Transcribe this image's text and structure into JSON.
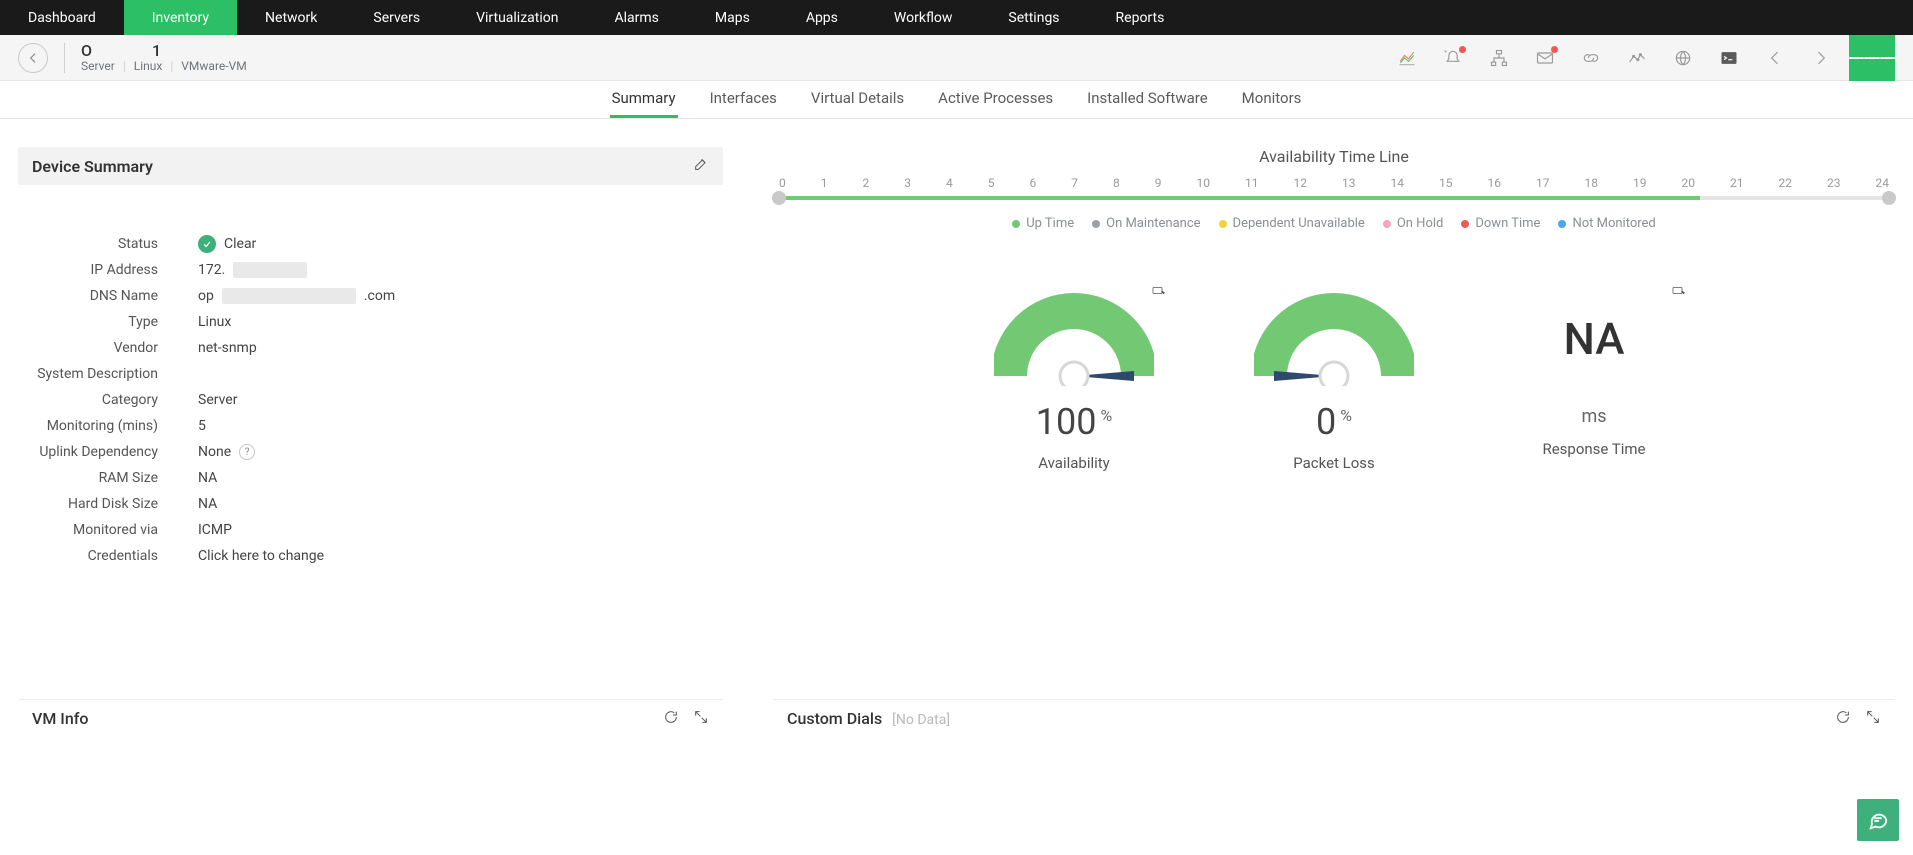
{
  "nav": {
    "items": [
      "Dashboard",
      "Inventory",
      "Network",
      "Servers",
      "Virtualization",
      "Alarms",
      "Maps",
      "Apps",
      "Workflow",
      "Settings",
      "Reports"
    ],
    "activeIndex": 1
  },
  "header": {
    "devicePrefix": "O",
    "deviceSuffix": "1",
    "crumbs": [
      "Server",
      "Linux",
      "VMware-VM"
    ]
  },
  "subtabs": {
    "items": [
      "Summary",
      "Interfaces",
      "Virtual Details",
      "Active Processes",
      "Installed Software",
      "Monitors"
    ],
    "activeIndex": 0
  },
  "deviceSummary": {
    "title": "Device Summary",
    "rows": {
      "statusLabel": "Status",
      "statusValue": "Clear",
      "ipLabel": "IP Address",
      "ipPrefix": "172.",
      "dnsLabel": "DNS Name",
      "dnsPrefix": "op",
      "dnsSuffix": ".com",
      "typeLabel": "Type",
      "typeValue": "Linux",
      "vendorLabel": "Vendor",
      "vendorValue": "net-snmp",
      "sysdescLabel": "System Description",
      "sysdescValue": "",
      "categoryLabel": "Category",
      "categoryValue": "Server",
      "monLabel": "Monitoring (mins)",
      "monValue": "5",
      "uplinkLabel": "Uplink Dependency",
      "uplinkValue": "None",
      "ramLabel": "RAM Size",
      "ramValue": "NA",
      "hdLabel": "Hard Disk Size",
      "hdValue": "NA",
      "viaLabel": "Monitored via",
      "viaValue": "ICMP",
      "credLabel": "Credentials",
      "credValue": "Click here to change"
    }
  },
  "timeline": {
    "title": "Availability Time Line",
    "ticks": [
      "0",
      "1",
      "2",
      "3",
      "4",
      "5",
      "6",
      "7",
      "8",
      "9",
      "10",
      "11",
      "12",
      "13",
      "14",
      "15",
      "16",
      "17",
      "18",
      "19",
      "20",
      "21",
      "22",
      "23",
      "24"
    ],
    "fillPercent": 83,
    "legend": [
      {
        "label": "Up Time",
        "color": "#72c873"
      },
      {
        "label": "On Maintenance",
        "color": "#9aa0a4"
      },
      {
        "label": "Dependent Unavailable",
        "color": "#f4d33a"
      },
      {
        "label": "On Hold",
        "color": "#f2a6c0"
      },
      {
        "label": "Down Time",
        "color": "#e95b5b"
      },
      {
        "label": "Not Monitored",
        "color": "#4aa7e8"
      }
    ]
  },
  "gauges": {
    "availability": {
      "value": "100",
      "unit": "%",
      "label": "Availability"
    },
    "packetLoss": {
      "value": "0",
      "unit": "%",
      "label": "Packet Loss"
    },
    "responseTime": {
      "value": "NA",
      "unit": "ms",
      "label": "Response Time"
    }
  },
  "lower": {
    "vmInfoTitle": "VM Info",
    "customDialsTitle": "Custom Dials",
    "noData": "[No Data]"
  },
  "help": "?"
}
